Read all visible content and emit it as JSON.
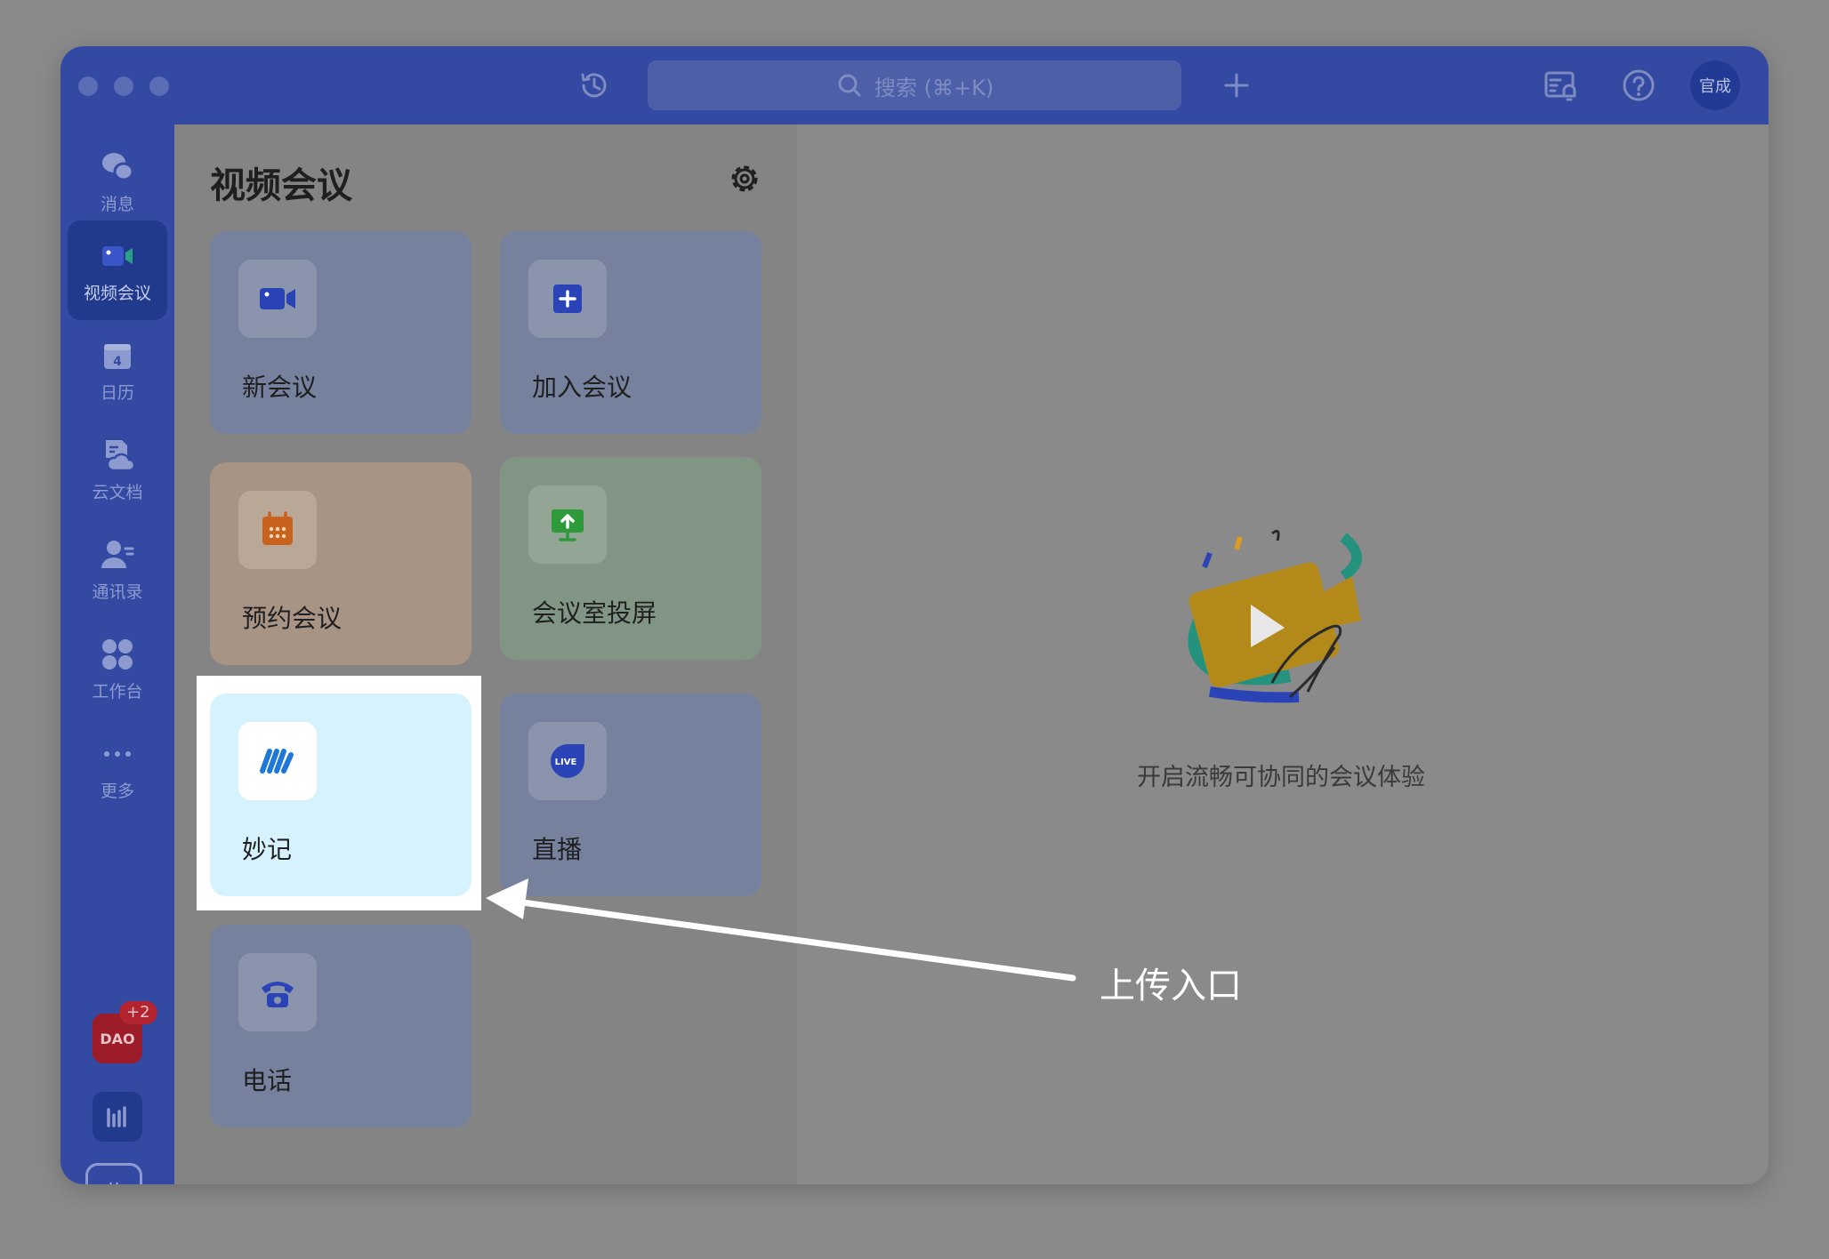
{
  "titlebar": {
    "search_placeholder": "搜索 (⌘+K)",
    "avatar_text": "官成"
  },
  "nav": {
    "items": [
      {
        "label": "消息",
        "icon": "chat-bubbles-icon"
      },
      {
        "label": "视频会议",
        "icon": "video-camera-icon",
        "active": true
      },
      {
        "label": "日历",
        "icon": "calendar-icon"
      },
      {
        "label": "云文档",
        "icon": "cloud-doc-icon"
      },
      {
        "label": "通讯录",
        "icon": "contacts-icon"
      },
      {
        "label": "工作台",
        "icon": "workspace-grid-icon"
      },
      {
        "label": "更多",
        "icon": "more-dots-icon"
      }
    ],
    "podcast_app_text": "DAO",
    "podcast_badge": "+2",
    "profile_text": "黄"
  },
  "panel": {
    "title": "视频会议",
    "cards": [
      {
        "label": "新会议",
        "icon": "video-camera-icon"
      },
      {
        "label": "加入会议",
        "icon": "plus-square-icon"
      },
      {
        "label": "预约会议",
        "icon": "calendar-schedule-icon"
      },
      {
        "label": "会议室投屏",
        "icon": "screen-share-icon"
      },
      {
        "label": "妙记",
        "icon": "minutes-logo-icon"
      },
      {
        "label": "直播",
        "icon": "live-icon",
        "icon_text": "LIVE"
      },
      {
        "label": "电话",
        "icon": "phone-icon"
      }
    ]
  },
  "content": {
    "empty_text": "开启流畅可协同的会议体验"
  },
  "annotation": {
    "text": "上传入口"
  },
  "colors": {
    "brand_blue": "#3349a2",
    "highlight_card": "#d6f3fd"
  }
}
